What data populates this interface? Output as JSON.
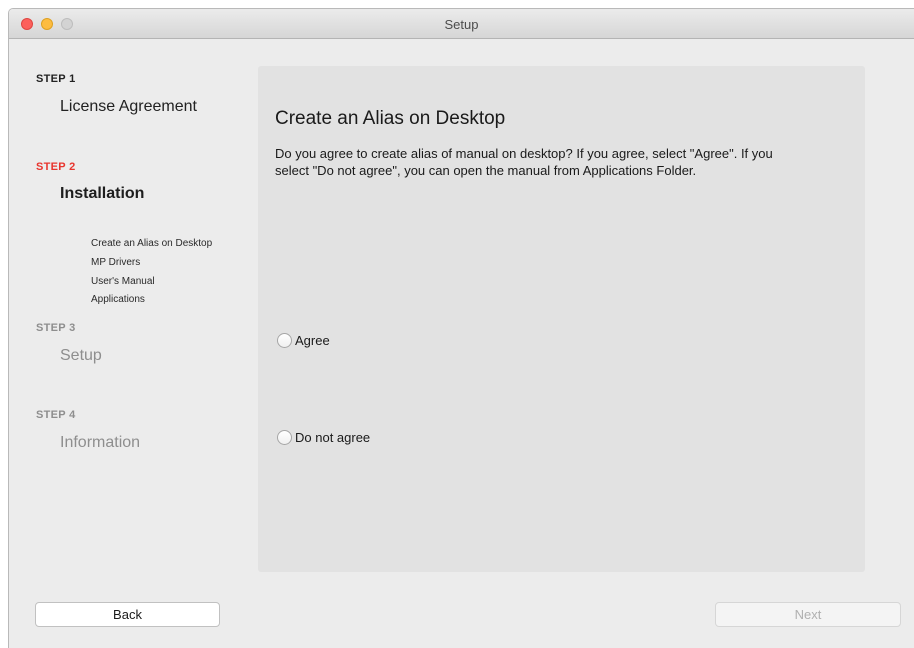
{
  "window": {
    "title": "Setup"
  },
  "steps": [
    {
      "label": "STEP 1",
      "title": "License Agreement",
      "state": "done"
    },
    {
      "label": "STEP 2",
      "title": "Installation",
      "state": "active",
      "substeps": [
        "Create an Alias on Desktop",
        "MP Drivers",
        "User's Manual",
        "Applications"
      ]
    },
    {
      "label": "STEP 3",
      "title": "Setup",
      "state": "pending"
    },
    {
      "label": "STEP 4",
      "title": "Information",
      "state": "pending"
    }
  ],
  "content": {
    "heading": "Create an Alias on Desktop",
    "description": "Do you agree to create alias of manual on desktop? If you agree, select \"Agree\". If you select \"Do not agree\", you can open the manual from Applications Folder.",
    "options": [
      {
        "label": "Agree",
        "selected": false
      },
      {
        "label": "Do not agree",
        "selected": false
      }
    ]
  },
  "buttons": {
    "back": "Back",
    "next": "Next",
    "next_enabled": false
  },
  "colors": {
    "active_step": "#e8352e",
    "pending_step": "#8e8e8e",
    "panel_background": "#e2e2e2"
  }
}
